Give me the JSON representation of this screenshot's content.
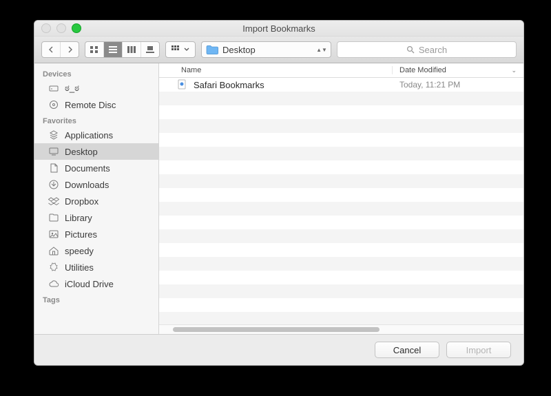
{
  "window": {
    "title": "Import Bookmarks"
  },
  "traffic": {
    "close": "#e2e2e2",
    "min": "#e2e2e2",
    "zoom": "#28c840"
  },
  "toolbar": {
    "path_label": "Desktop",
    "search_placeholder": "Search"
  },
  "sidebar": {
    "sections": [
      {
        "header": "Devices",
        "items": [
          {
            "icon": "drive",
            "label": "ಠ_ಠ"
          },
          {
            "icon": "disc",
            "label": "Remote Disc"
          }
        ]
      },
      {
        "header": "Favorites",
        "items": [
          {
            "icon": "apps",
            "label": "Applications"
          },
          {
            "icon": "desktop",
            "label": "Desktop",
            "selected": true
          },
          {
            "icon": "docs",
            "label": "Documents"
          },
          {
            "icon": "downloads",
            "label": "Downloads"
          },
          {
            "icon": "dropbox",
            "label": "Dropbox"
          },
          {
            "icon": "folder",
            "label": "Library"
          },
          {
            "icon": "pictures",
            "label": "Pictures"
          },
          {
            "icon": "home",
            "label": "speedy"
          },
          {
            "icon": "utilities",
            "label": "Utilities"
          },
          {
            "icon": "cloud",
            "label": "iCloud Drive"
          }
        ]
      },
      {
        "header": "Tags",
        "items": []
      }
    ]
  },
  "columns": {
    "name": "Name",
    "date": "Date Modified"
  },
  "rows": [
    {
      "icon": "webdoc",
      "name": "Safari Bookmarks",
      "date": "Today, 11:21 PM"
    }
  ],
  "footer": {
    "cancel": "Cancel",
    "import": "Import"
  }
}
